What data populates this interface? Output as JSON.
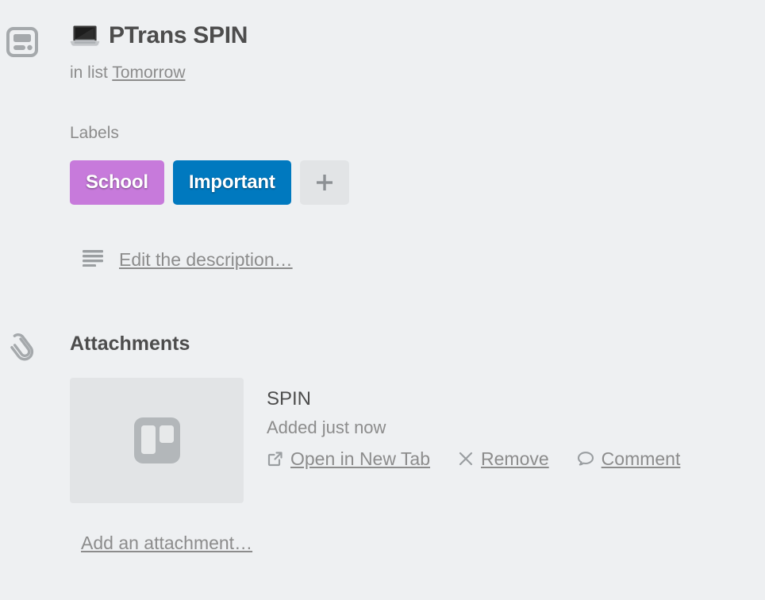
{
  "theme": {
    "background": "#eef0f2",
    "text_dark": "#4d4d4d",
    "text_muted": "#8c8c8c",
    "tile": "#e2e4e6"
  },
  "card": {
    "icon": "card-window-icon",
    "emoji": "💻",
    "emoji_name": "laptop-emoji",
    "title": "PTrans SPIN",
    "in_list_prefix": "in list",
    "list_name": "Tomorrow"
  },
  "labels": {
    "heading": "Labels",
    "items": [
      {
        "text": "School",
        "color": "#c77adb"
      },
      {
        "text": "Important",
        "color": "#0079bf"
      }
    ],
    "add_label": "+"
  },
  "description": {
    "icon": "description-lines-icon",
    "link_text": "Edit the description…"
  },
  "attachments": {
    "icon": "paperclip-icon",
    "heading": "Attachments",
    "items": [
      {
        "thumb_icon": "trello-logo-icon",
        "name": "SPIN",
        "meta": "Added just now",
        "actions": [
          {
            "icon": "external-link-icon",
            "label": "Open in New Tab"
          },
          {
            "icon": "close-x-icon",
            "label": "Remove"
          },
          {
            "icon": "comment-bubble-icon",
            "label": "Comment"
          }
        ]
      }
    ],
    "add_link": "Add an attachment…"
  }
}
